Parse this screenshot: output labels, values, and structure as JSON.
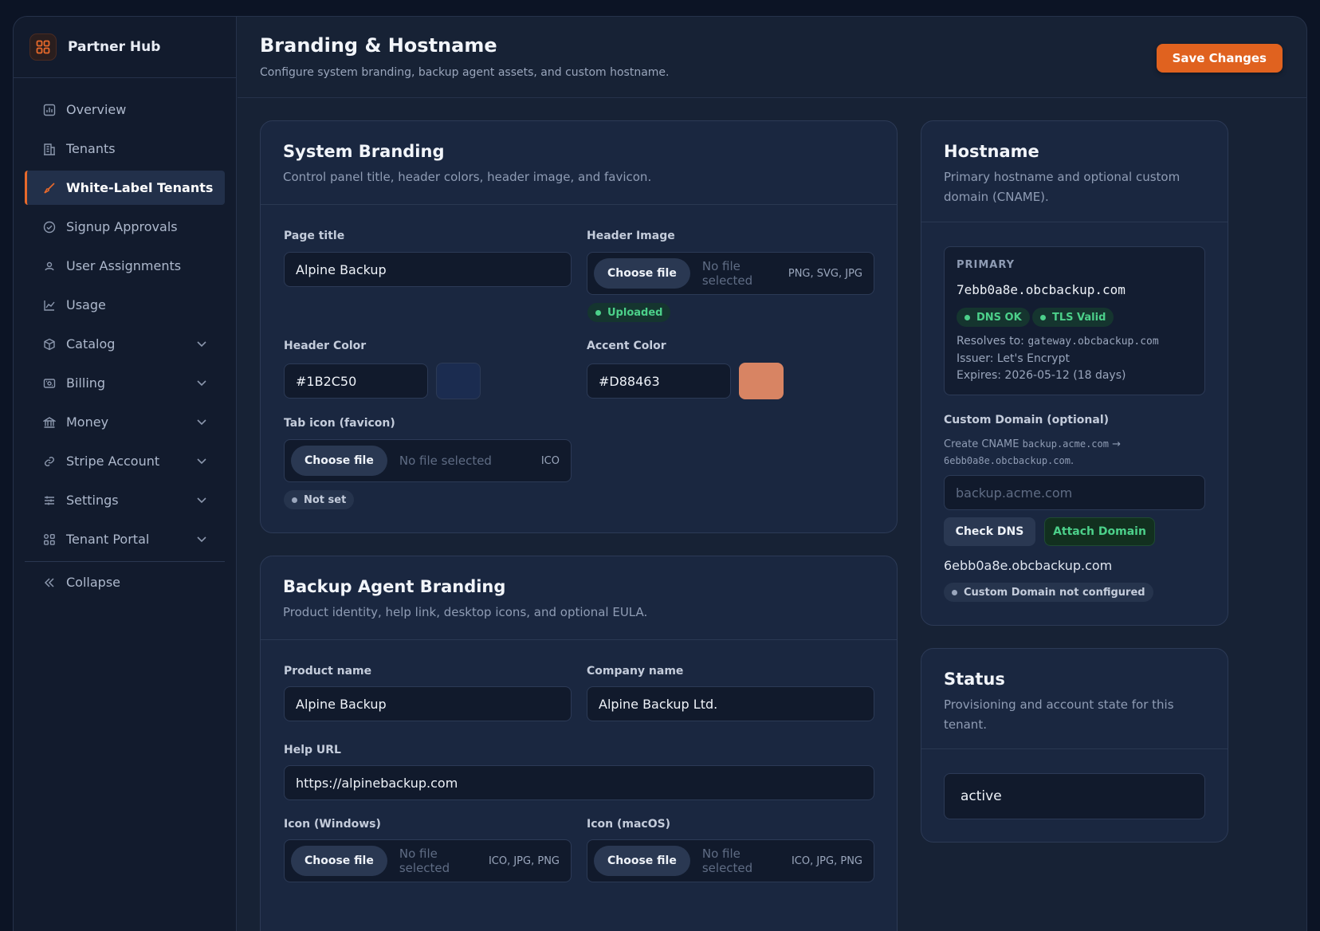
{
  "app": {
    "name": "Partner Hub"
  },
  "sidebar": {
    "items": [
      {
        "label": "Overview",
        "icon": "chart-icon"
      },
      {
        "label": "Tenants",
        "icon": "building-icon"
      },
      {
        "label": "White-Label Tenants",
        "icon": "brush-icon",
        "active": true
      },
      {
        "label": "Signup Approvals",
        "icon": "check-circle-icon"
      },
      {
        "label": "User Assignments",
        "icon": "user-icon"
      },
      {
        "label": "Usage",
        "icon": "line-chart-icon"
      },
      {
        "label": "Catalog",
        "icon": "box-icon",
        "expandable": true
      },
      {
        "label": "Billing",
        "icon": "receipt-icon",
        "expandable": true
      },
      {
        "label": "Money",
        "icon": "bank-icon",
        "expandable": true
      },
      {
        "label": "Stripe Account",
        "icon": "link-icon",
        "expandable": true
      },
      {
        "label": "Settings",
        "icon": "sliders-icon",
        "expandable": true
      },
      {
        "label": "Tenant Portal",
        "icon": "grid-icon",
        "expandable": true
      }
    ],
    "collapse_label": "Collapse"
  },
  "header": {
    "title": "Branding & Hostname",
    "subtitle": "Configure system branding, backup agent assets, and custom hostname.",
    "save_label": "Save Changes"
  },
  "system_branding": {
    "title": "System Branding",
    "subtitle": "Control panel title, header colors, header image, and favicon.",
    "page_title_label": "Page title",
    "page_title_value": "Alpine Backup",
    "header_image_label": "Header Image",
    "header_image": {
      "button": "Choose file",
      "placeholder": "No file selected",
      "types": "PNG, SVG, JPG",
      "status": "Uploaded"
    },
    "header_color_label": "Header Color",
    "header_color_value": "#1B2C50",
    "accent_color_label": "Accent Color",
    "accent_color_value": "#D88463",
    "favicon_label": "Tab icon (favicon)",
    "favicon": {
      "button": "Choose file",
      "placeholder": "No file selected",
      "types": "ICO",
      "status": "Not set"
    }
  },
  "agent_branding": {
    "title": "Backup Agent Branding",
    "subtitle": "Product identity, help link, desktop icons, and optional EULA.",
    "product_name_label": "Product name",
    "product_name_value": "Alpine Backup",
    "company_name_label": "Company name",
    "company_name_value": "Alpine Backup Ltd.",
    "help_url_label": "Help URL",
    "help_url_value": "https://alpinebackup.com",
    "icon_windows_label": "Icon (Windows)",
    "icon_windows": {
      "button": "Choose file",
      "placeholder": "No file selected",
      "types": "ICO, JPG, PNG"
    },
    "icon_macos_label": "Icon (macOS)",
    "icon_macos": {
      "button": "Choose file",
      "placeholder": "No file selected",
      "types": "ICO, JPG, PNG"
    }
  },
  "hostname": {
    "title": "Hostname",
    "subtitle": "Primary hostname and optional custom domain (CNAME).",
    "primary_label": "PRIMARY",
    "primary_host": "7ebb0a8e.obcbackup.com",
    "dns_badge": "DNS OK",
    "tls_badge": "TLS Valid",
    "resolves_prefix": "Resolves to: ",
    "resolves_value": "gateway.obcbackup.com",
    "issuer": "Issuer: Let's Encrypt",
    "expires": "Expires: 2026-05-12 (18 days)",
    "custom_label": "Custom Domain (optional)",
    "cname_prefix": "Create CNAME ",
    "cname_from": "backup.acme.com",
    "cname_arrow": " →",
    "cname_to": "6ebb0a8e.obcbackup.com",
    "cname_suffix": ".",
    "custom_placeholder": "backup.acme.com",
    "check_dns": "Check DNS",
    "attach_domain": "Attach Domain",
    "target_host": "6ebb0a8e.obcbackup.com",
    "custom_status": "Custom Domain not configured"
  },
  "status": {
    "title": "Status",
    "subtitle": "Provisioning and account state for this tenant.",
    "value": "active"
  },
  "colors": {
    "accent": "#e0621f",
    "header_swatch": "#1B2C50",
    "accent_swatch": "#D88463"
  }
}
